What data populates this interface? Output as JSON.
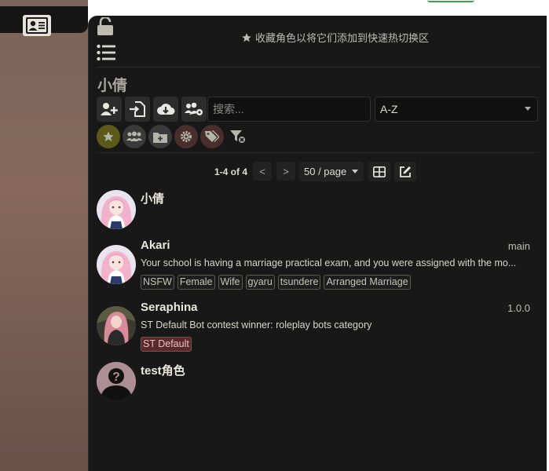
{
  "header": {
    "hotswap_hint": "收藏角色以将它们添加到快速热切换区"
  },
  "panel": {
    "title": "小倩",
    "search_placeholder": "搜索...",
    "sort_value": "A-Z"
  },
  "pagination": {
    "info": "1-4 of 4",
    "prev": "<",
    "next": ">",
    "page_size": "50 / page"
  },
  "characters": [
    {
      "name": "小倩",
      "version": "",
      "description": "",
      "tags": []
    },
    {
      "name": "Akari",
      "version": "main",
      "description": "Your school is having a marriage practical exam, and you were assigned with the mo...",
      "tags": [
        "NSFW",
        "Female",
        "Wife",
        "gyaru",
        "tsundere",
        "Arranged Marriage"
      ]
    },
    {
      "name": "Seraphina",
      "version": "1.0.0",
      "description": "ST Default Bot contest winner: roleplay bots category",
      "tags": [
        "ST Default"
      ]
    },
    {
      "name": "test角色",
      "version": "",
      "description": "",
      "tags": []
    }
  ],
  "icons": {
    "lock": "unlock-icon",
    "list": "list-icon",
    "star": "star-icon",
    "card": "character-card-icon"
  },
  "colors": {
    "panel_bg": "#181818",
    "accent_fav": "#5c5a1a",
    "tag_default": "#5a2a2a"
  }
}
